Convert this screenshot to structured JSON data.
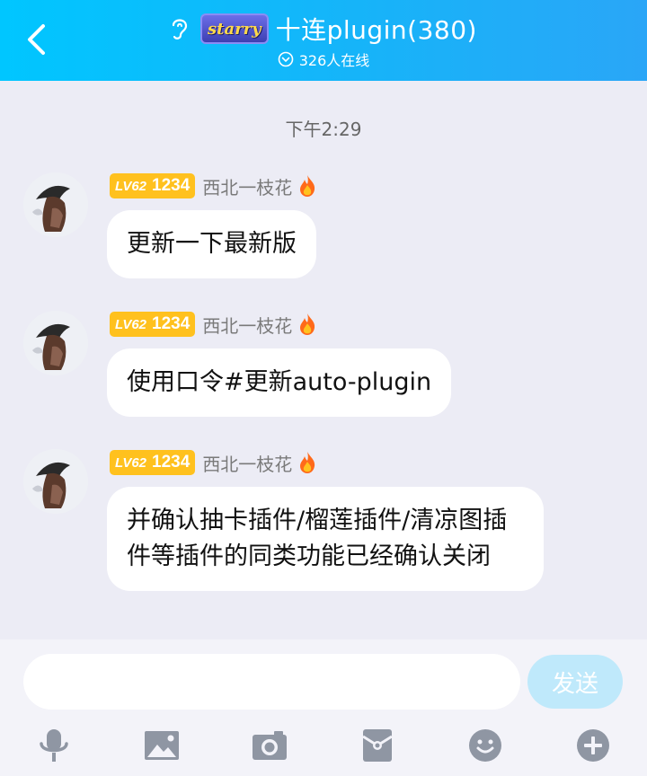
{
  "header": {
    "group_badge": "starry",
    "title": "十连plugin(380)",
    "online": "326人在线"
  },
  "chat": {
    "timestamp": "下午2:29",
    "messages": [
      {
        "level": "LV62",
        "level_num": "1234",
        "sender": "西北一枝花",
        "text": "更新一下最新版"
      },
      {
        "level": "LV62",
        "level_num": "1234",
        "sender": "西北一枝花",
        "text": "使用口令#更新auto-plugin"
      },
      {
        "level": "LV62",
        "level_num": "1234",
        "sender": "西北一枝花",
        "text": "并确认抽卡插件/榴莲插件/清凉图插件等插件的同类功能已经确认关闭"
      }
    ]
  },
  "input": {
    "value": "",
    "placeholder": "",
    "send_label": "发送"
  },
  "toolbar": {
    "icons": [
      "microphone-icon",
      "image-icon",
      "camera-icon",
      "red-packet-icon",
      "emoji-icon",
      "plus-icon"
    ]
  },
  "colors": {
    "header_start": "#00c6ff",
    "header_end": "#2aa6f7",
    "background": "#ececf5",
    "level_badge": "#ffc11e",
    "send_button": "#bfe9fb",
    "toolbar_icon": "#8f96a3"
  }
}
